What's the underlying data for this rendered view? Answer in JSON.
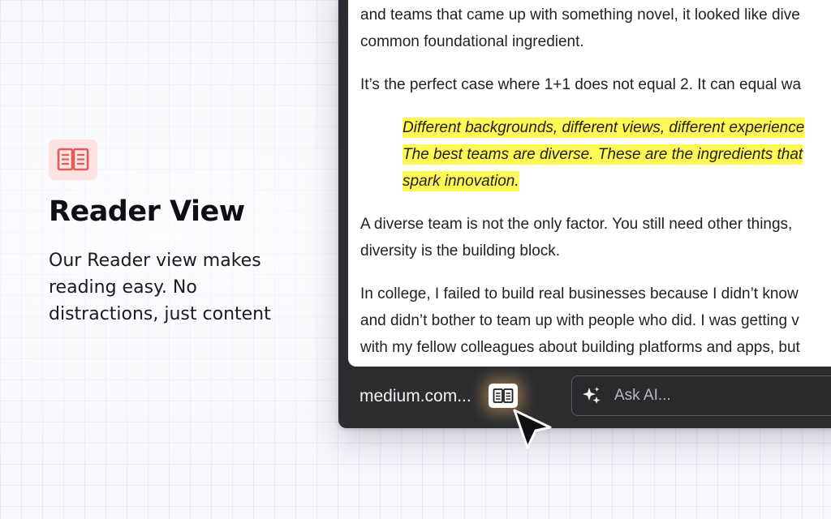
{
  "feature": {
    "icon": "open-book-icon",
    "title": "Reader View",
    "description_lines": [
      "Our Reader view makes",
      "reading easy. No",
      "distractions, just content"
    ]
  },
  "article": {
    "paragraph1": [
      "and teams that came up with something novel, it looked like dive",
      "common foundational ingredient."
    ],
    "paragraph2": "It’s the perfect case where 1+1 does not equal 2. It can equal wa",
    "quote": [
      "Different backgrounds, different views, different experience",
      "The best teams are diverse. These are the ingredients that",
      "spark innovation."
    ],
    "paragraph3": [
      "A diverse team is not the only factor. You still need other things,",
      "diversity is the building block."
    ],
    "paragraph4": [
      "In college, I failed to build real businesses because I didn’t know",
      "and didn’t bother to team up with people who did. I was getting v",
      "with my fellow colleagues about building platforms and apps, but"
    ]
  },
  "bottom_bar": {
    "url": "medium.com...",
    "reader_button_icon": "open-book-icon",
    "ask_ai": {
      "icon": "sparkle-icon",
      "placeholder": "Ask AI..."
    }
  },
  "colors": {
    "badge_bg": "#fde2e2",
    "badge_icon": "#e25a5a",
    "highlight": "#fff855",
    "window_bg": "#2d2d30"
  }
}
